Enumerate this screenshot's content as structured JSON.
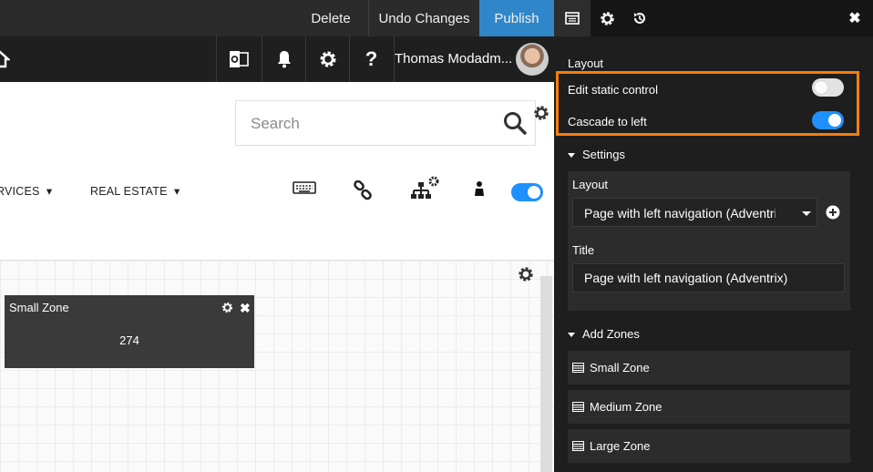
{
  "toolbar": {
    "delete_label": "Delete",
    "undo_label": "Undo Changes",
    "publish_label": "Publish",
    "publish_color": "#2f86c8"
  },
  "header": {
    "user_name": "Thomas Modadm...",
    "icons": [
      "home-icon",
      "outlook-icon",
      "bell-icon",
      "gear-icon",
      "help-icon"
    ],
    "help_glyph": "?"
  },
  "search": {
    "placeholder": "Search"
  },
  "nav": {
    "items": [
      {
        "label": "RVICES"
      },
      {
        "label": "REAL ESTATE"
      }
    ]
  },
  "tools": {
    "icons": [
      "keyboard-icon",
      "link-icon",
      "sitemap-icon",
      "person-icon"
    ],
    "toggle_on": true,
    "accent_color": "#1e90ff"
  },
  "canvas": {
    "zone": {
      "title": "Small Zone",
      "value": "274"
    }
  },
  "panel": {
    "tabs": [
      "layout-icon",
      "gear-icon",
      "history-icon"
    ],
    "close_glyph": "✖",
    "layout_heading": "Layout",
    "highlight_color": "#f57f0b",
    "toggles": [
      {
        "label": "Edit static control",
        "on": false
      },
      {
        "label": "Cascade to left",
        "on": true
      }
    ],
    "settings": {
      "heading": "Settings",
      "layout_label": "Layout",
      "layout_value": "Page with left navigation (Adventrix)",
      "title_label": "Title",
      "title_value": "Page with left navigation (Adventrix)"
    },
    "zones": {
      "heading": "Add Zones",
      "items": [
        {
          "label": "Small Zone"
        },
        {
          "label": "Medium Zone"
        },
        {
          "label": "Large Zone"
        }
      ]
    }
  }
}
